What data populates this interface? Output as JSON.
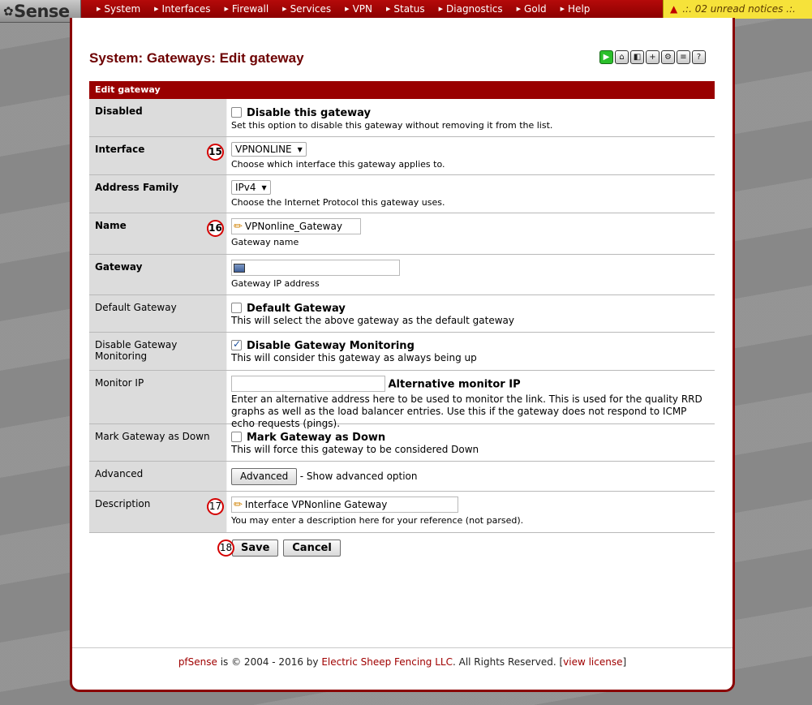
{
  "brand": {
    "logo_text": "Sense",
    "logo_glyph": "✿"
  },
  "nav": [
    "System",
    "Interfaces",
    "Firewall",
    "Services",
    "VPN",
    "Status",
    "Diagnostics",
    "Gold",
    "Help"
  ],
  "notice": {
    "text": ".:. 02 unread notices .:.",
    "icon": "warning-triangle-icon"
  },
  "page_title": "System: Gateways: Edit gateway",
  "toolbar_icons": [
    "play-icon",
    "home-icon",
    "restore-icon",
    "add-icon",
    "settings-icon",
    "list-icon",
    "help-icon"
  ],
  "form": {
    "header": "Edit gateway",
    "disabled": {
      "label": "Disabled",
      "checkbox_label": "Disable this gateway",
      "help": "Set this option to disable this gateway without removing it from the list.",
      "checked": false
    },
    "interface": {
      "label": "Interface",
      "badge": "15",
      "value": "VPNONLINE",
      "help": "Choose which interface this gateway applies to."
    },
    "address_family": {
      "label": "Address Family",
      "value": "IPv4",
      "help": "Choose the Internet Protocol this gateway uses."
    },
    "name": {
      "label": "Name",
      "badge": "16",
      "value": "VPNonline_Gateway",
      "help": "Gateway name"
    },
    "gateway": {
      "label": "Gateway",
      "value": "",
      "help": "Gateway IP address"
    },
    "default_gateway": {
      "label": "Default Gateway",
      "checkbox_label": "Default Gateway",
      "help": "This will select the above gateway as the default gateway",
      "checked": false
    },
    "disable_monitoring": {
      "label": "Disable Gateway Monitoring",
      "checkbox_label": "Disable Gateway Monitoring",
      "help": "This will consider this gateway as always being up",
      "checked": true
    },
    "monitor_ip": {
      "label": "Monitor IP",
      "value": "",
      "inline_label": "Alternative monitor IP",
      "help": "Enter an alternative address here to be used to monitor the link. This is used for the quality RRD graphs as well as the load balancer entries. Use this if the gateway does not respond to ICMP echo requests (pings)."
    },
    "mark_down": {
      "label": "Mark Gateway as Down",
      "checkbox_label": "Mark Gateway as Down",
      "help": "This will force this gateway to be considered Down",
      "checked": false
    },
    "advanced": {
      "label": "Advanced",
      "button": "Advanced",
      "suffix": "- Show advanced option"
    },
    "description": {
      "label": "Description",
      "badge": "17",
      "value": "Interface VPNonline Gateway",
      "help": "You may enter a description here for your reference (not parsed)."
    },
    "save_badge": "18",
    "save_label": "Save",
    "cancel_label": "Cancel"
  },
  "footer": {
    "brand": "pfSense",
    "text": " is © 2004 - 2016 by ",
    "company": "Electric Sheep Fencing LLC",
    "rights": ". All Rights Reserved. [",
    "license_link": "view license",
    "close": "]"
  }
}
